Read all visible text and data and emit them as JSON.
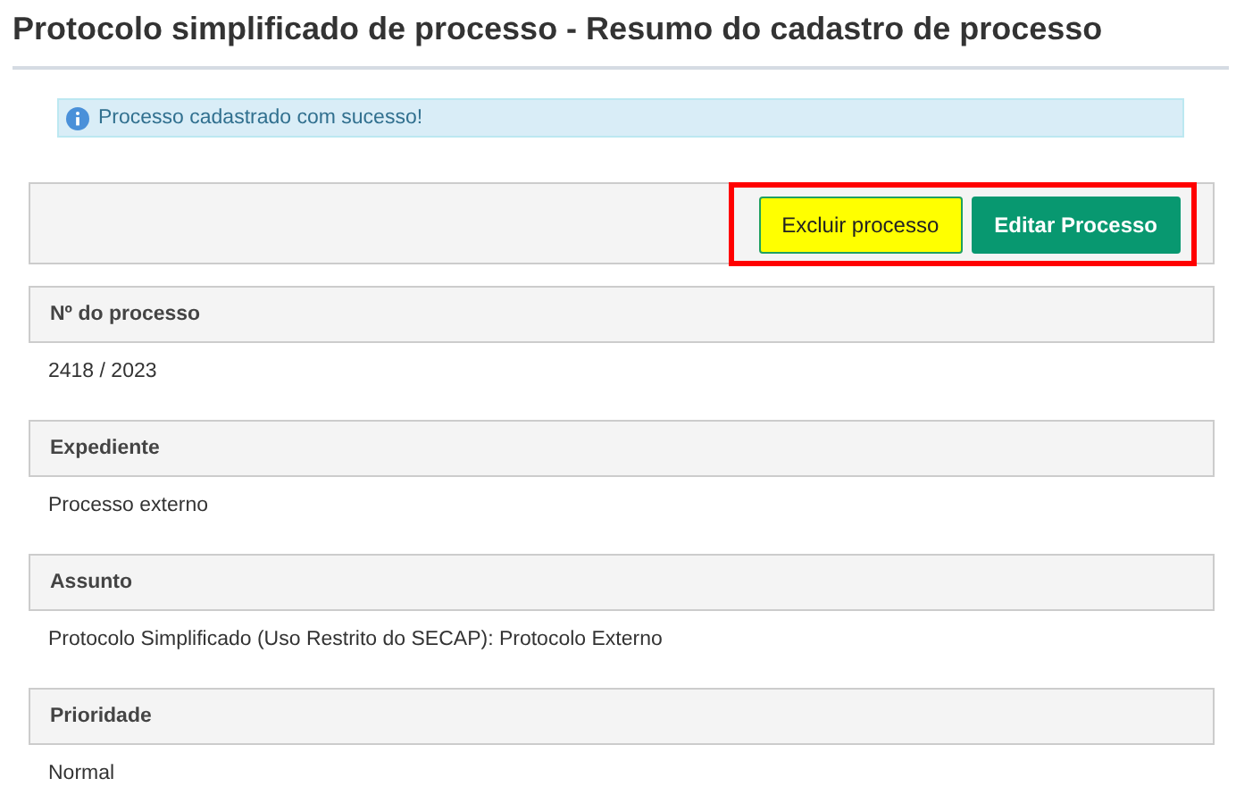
{
  "title": "Protocolo simplificado de processo - Resumo do cadastro de processo",
  "alert": {
    "text": "Processo cadastrado com sucesso!"
  },
  "toolbar": {
    "highlighted": true,
    "buttons": [
      {
        "label": "Excluir processo",
        "kind": "danger"
      },
      {
        "label": "Editar Processo",
        "kind": "primary"
      }
    ]
  },
  "fields": [
    {
      "label": "Nº do processo",
      "value": "2418 / 2023"
    },
    {
      "label": "Expediente",
      "value": "Processo externo"
    },
    {
      "label": "Assunto",
      "value": "Protocolo Simplificado (Uso Restrito do SECAP): Protocolo Externo"
    },
    {
      "label": "Prioridade",
      "value": "Normal"
    }
  ]
}
